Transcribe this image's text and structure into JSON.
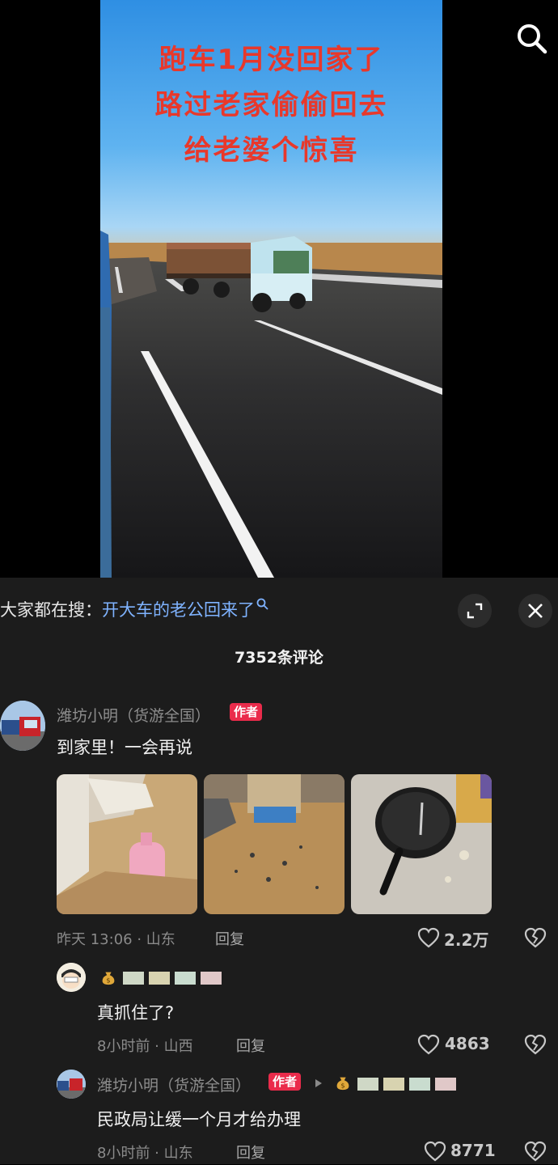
{
  "video": {
    "overlay_lines": [
      "跑车1月没回家了",
      "路过老家偷偷回去",
      "给老婆个惊喜"
    ]
  },
  "colors": {
    "overlay_text": "#e8382b",
    "hot_keyword": "#7fb3ff",
    "author_badge": "#ea2b4b",
    "sheet_bg": "#1c1c1c"
  },
  "hot_search": {
    "prefix": "大家都在搜：",
    "keyword": "开大车的老公回来了"
  },
  "comments_header": {
    "count_label": "7352条评论"
  },
  "comments": [
    {
      "username": "潍坊小明（货游全国）",
      "badge": "作者",
      "text": "到家里！一会再说",
      "meta": "昨天 13:06 · 山东",
      "reply_label": "回复",
      "likes": "2.2万",
      "images": [
        "bathroom-floor-photo",
        "broken-glass-floor-photo",
        "wok-photo"
      ]
    },
    {
      "username": "",
      "text": "真抓住了?",
      "meta": "8小时前 · 山西",
      "reply_label": "回复",
      "likes": "4863"
    },
    {
      "username": "潍坊小明（货游全国）",
      "badge": "作者",
      "text": "民政局让缓一个月才给办理",
      "meta": "8小时前 · 山东",
      "reply_label": "回复",
      "likes": "8771"
    }
  ]
}
